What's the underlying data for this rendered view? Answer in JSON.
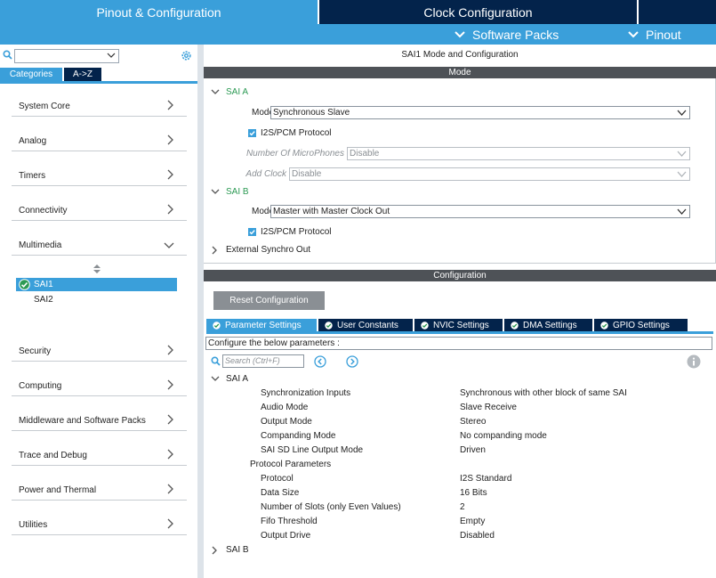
{
  "top_tabs": {
    "pinout": "Pinout & Configuration",
    "clock": "Clock Configuration"
  },
  "sub_menu": {
    "software_packs": "Software Packs",
    "pinout": "Pinout"
  },
  "left": {
    "search_value": "",
    "tab_categories": "Categories",
    "tab_az": "A->Z",
    "categories": [
      {
        "label": "System Core",
        "expanded": false
      },
      {
        "label": "Analog",
        "expanded": false
      },
      {
        "label": "Timers",
        "expanded": false
      },
      {
        "label": "Connectivity",
        "expanded": false
      },
      {
        "label": "Multimedia",
        "expanded": true
      },
      {
        "label": "Security",
        "expanded": false
      },
      {
        "label": "Computing",
        "expanded": false
      },
      {
        "label": "Middleware and Software Packs",
        "expanded": false
      },
      {
        "label": "Trace and Debug",
        "expanded": false
      },
      {
        "label": "Power and Thermal",
        "expanded": false
      },
      {
        "label": "Utilities",
        "expanded": false
      }
    ],
    "multimedia_items": [
      {
        "label": "SAI1",
        "selected": true,
        "enabled": true
      },
      {
        "label": "SAI2",
        "selected": false,
        "enabled": false
      }
    ]
  },
  "mode": {
    "title": "SAI1 Mode and Configuration",
    "section": "Mode",
    "sai_a": {
      "label": "SAI A",
      "mode_label": "Mode",
      "mode_value": "Synchronous Slave",
      "protocol_label": "I2S/PCM Protocol",
      "protocol_checked": true,
      "mics_label": "Number Of MicroPhones",
      "mics_value": "Disable",
      "clock_label": "Add Clock",
      "clock_value": "Disable"
    },
    "sai_b": {
      "label": "SAI B",
      "mode_label": "Mode",
      "mode_value": "Master with Master Clock Out",
      "protocol_label": "I2S/PCM Protocol",
      "protocol_checked": true
    },
    "external": "External Synchro Out"
  },
  "config": {
    "section": "Configuration",
    "reset_label": "Reset Configuration",
    "tabs": [
      "Parameter Settings",
      "User Constants",
      "NVIC Settings",
      "DMA Settings",
      "GPIO Settings"
    ],
    "hint": "Configure the below parameters :",
    "search_placeholder": "Search (Ctrl+F)",
    "group_a": "SAI A",
    "group_b": "SAI B",
    "params": [
      {
        "name": "Synchronization Inputs",
        "value": "Synchronous with other block of same SAI"
      },
      {
        "name": "Audio Mode",
        "value": "Slave Receive"
      },
      {
        "name": "Output Mode",
        "value": "Stereo"
      },
      {
        "name": "Companding Mode",
        "value": "No companding mode"
      },
      {
        "name": "SAI SD Line Output Mode",
        "value": "Driven"
      }
    ],
    "protocol_group": "Protocol Parameters",
    "protocol_params": [
      {
        "name": "Protocol",
        "value": "I2S Standard"
      },
      {
        "name": "Data Size",
        "value": "16 Bits"
      },
      {
        "name": "Number of Slots (only Even Values)",
        "value": "2"
      },
      {
        "name": "Fifo Threshold",
        "value": "Empty"
      },
      {
        "name": "Output Drive",
        "value": "Disabled"
      }
    ]
  },
  "colors": {
    "accent": "#3a9fda",
    "navy": "#03234b",
    "section_bar": "#4e5257",
    "green": "#2c9a54"
  }
}
